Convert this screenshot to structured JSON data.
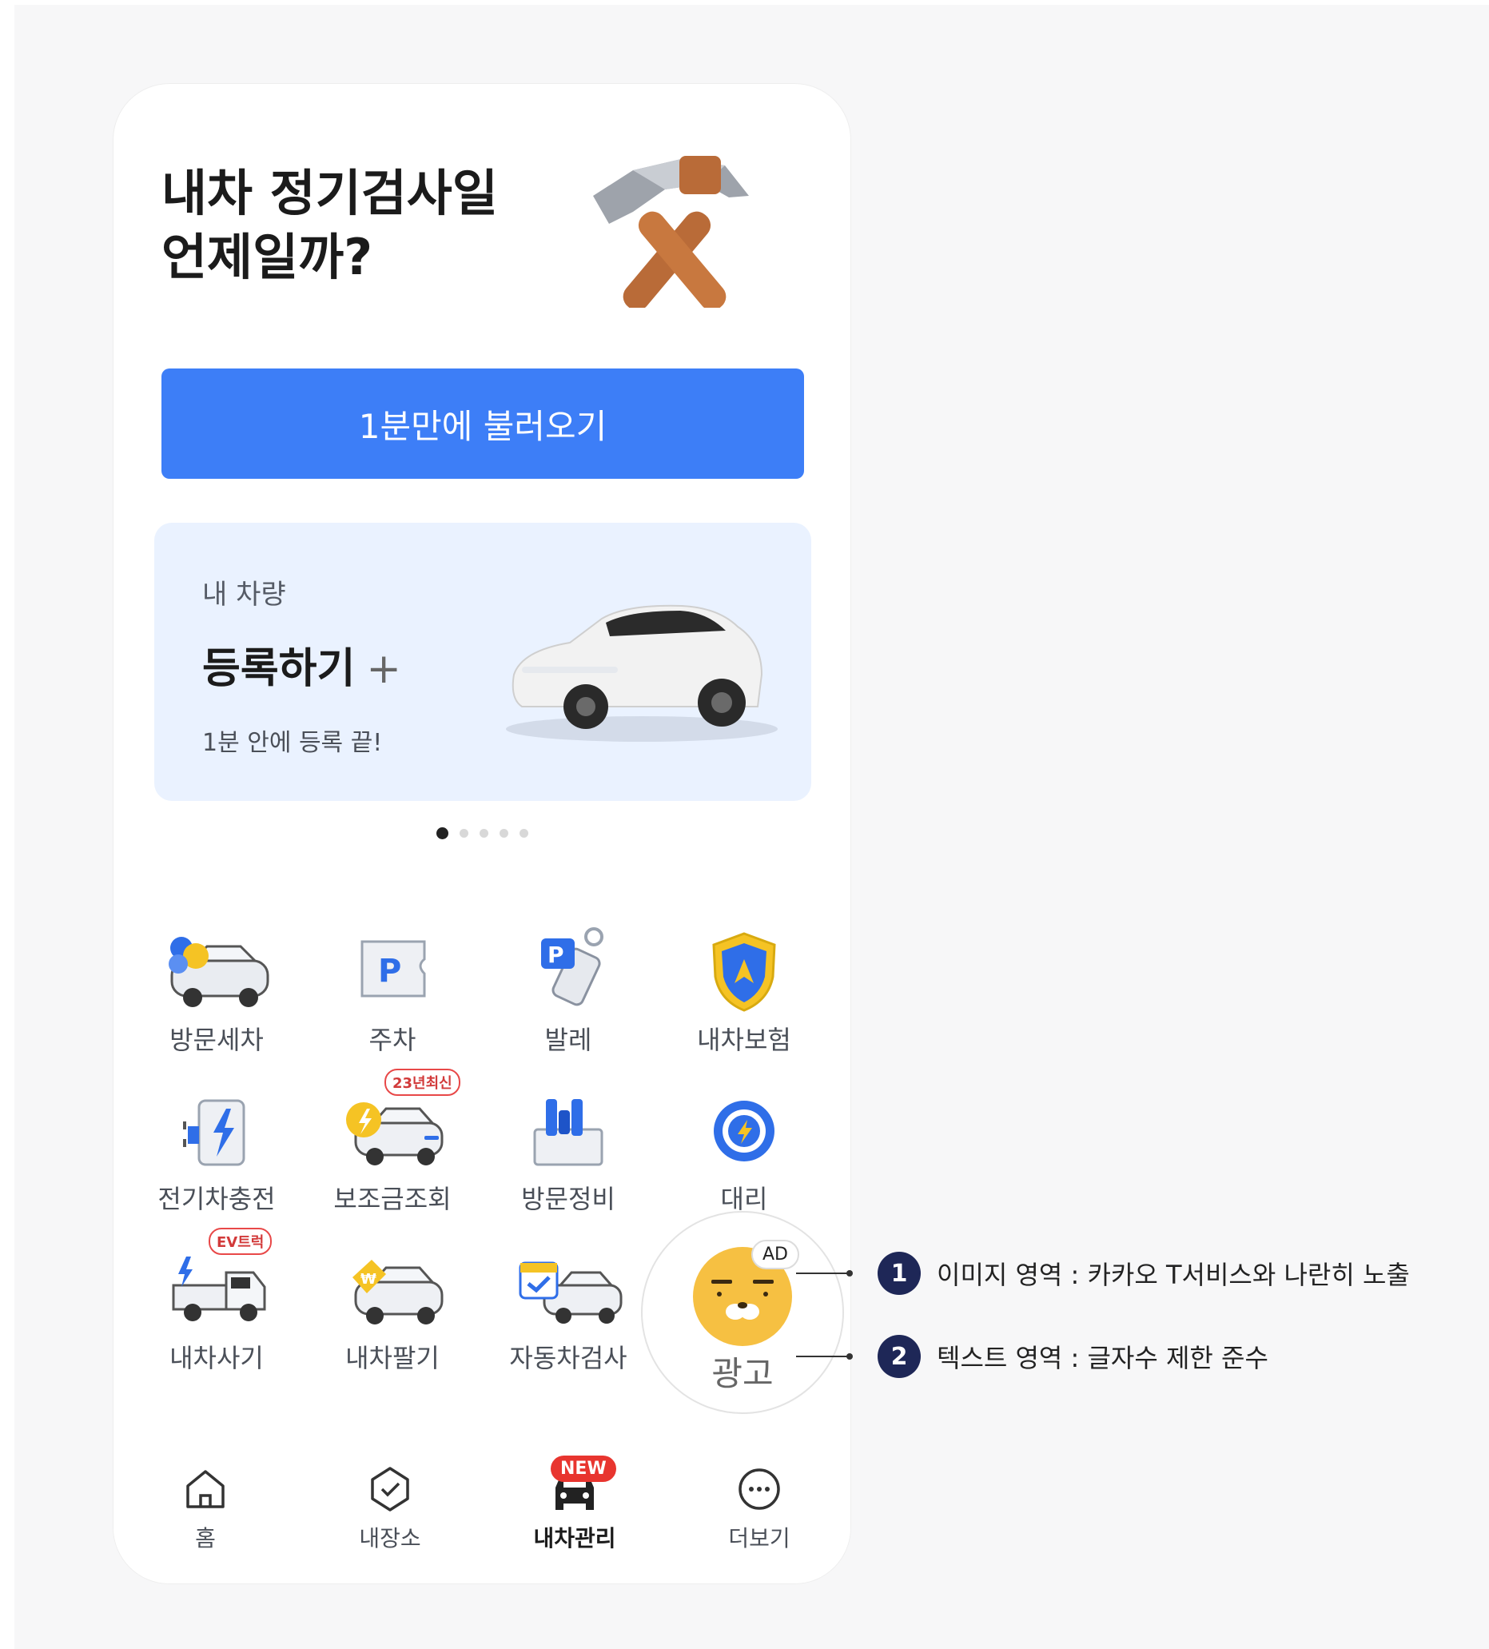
{
  "hero": {
    "title_line1": "내차 정기검사일",
    "title_line2": "언제일까?",
    "icon": "hammer-wrench-icon",
    "button_label": "1분만에 불러오기"
  },
  "card": {
    "label": "내 차량",
    "action": "등록하기",
    "plus": "+",
    "subtitle": "1분 안에 등록 끝!",
    "image": "white-car"
  },
  "carousel": {
    "page_count": 5,
    "active_index": 0
  },
  "services": [
    {
      "label": "방문세차",
      "icon": "car-wash-icon"
    },
    {
      "label": "주차",
      "icon": "parking-icon"
    },
    {
      "label": "발레",
      "icon": "valet-parking-icon"
    },
    {
      "label": "내차보험",
      "icon": "insurance-shield-icon"
    },
    {
      "label": "전기차충전",
      "icon": "ev-charger-icon"
    },
    {
      "label": "보조금조회",
      "icon": "subsidy-car-icon",
      "badge": "23년최신"
    },
    {
      "label": "방문정비",
      "icon": "maintenance-toolbox-icon"
    },
    {
      "label": "대리",
      "icon": "steering-wheel-icon"
    },
    {
      "label": "내차사기",
      "icon": "buy-truck-icon",
      "badge": "EV트럭"
    },
    {
      "label": "내차팔기",
      "icon": "sell-car-icon"
    },
    {
      "label": "자동차검사",
      "icon": "car-inspection-icon"
    }
  ],
  "ad": {
    "tag": "AD",
    "label": "광고",
    "icon": "ryan-character-icon"
  },
  "tabbar": {
    "items": [
      {
        "label": "홈",
        "icon": "home-icon"
      },
      {
        "label": "내장소",
        "icon": "shield-check-icon"
      },
      {
        "label": "내차관리",
        "icon": "car-icon",
        "active": true,
        "badge": "NEW"
      },
      {
        "label": "더보기",
        "icon": "more-icon"
      }
    ]
  },
  "annotations": [
    {
      "number": "1",
      "text": "이미지 영역 : 카카오 T서비스와 나란히 노출"
    },
    {
      "number": "2",
      "text": "텍스트 영역 : 글자수 제한 준수"
    }
  ],
  "colors": {
    "primary": "#3d7ef7",
    "card_bg": "#eaf2ff",
    "badge_red": "#e8352f",
    "annotation_num": "#1e2757"
  }
}
